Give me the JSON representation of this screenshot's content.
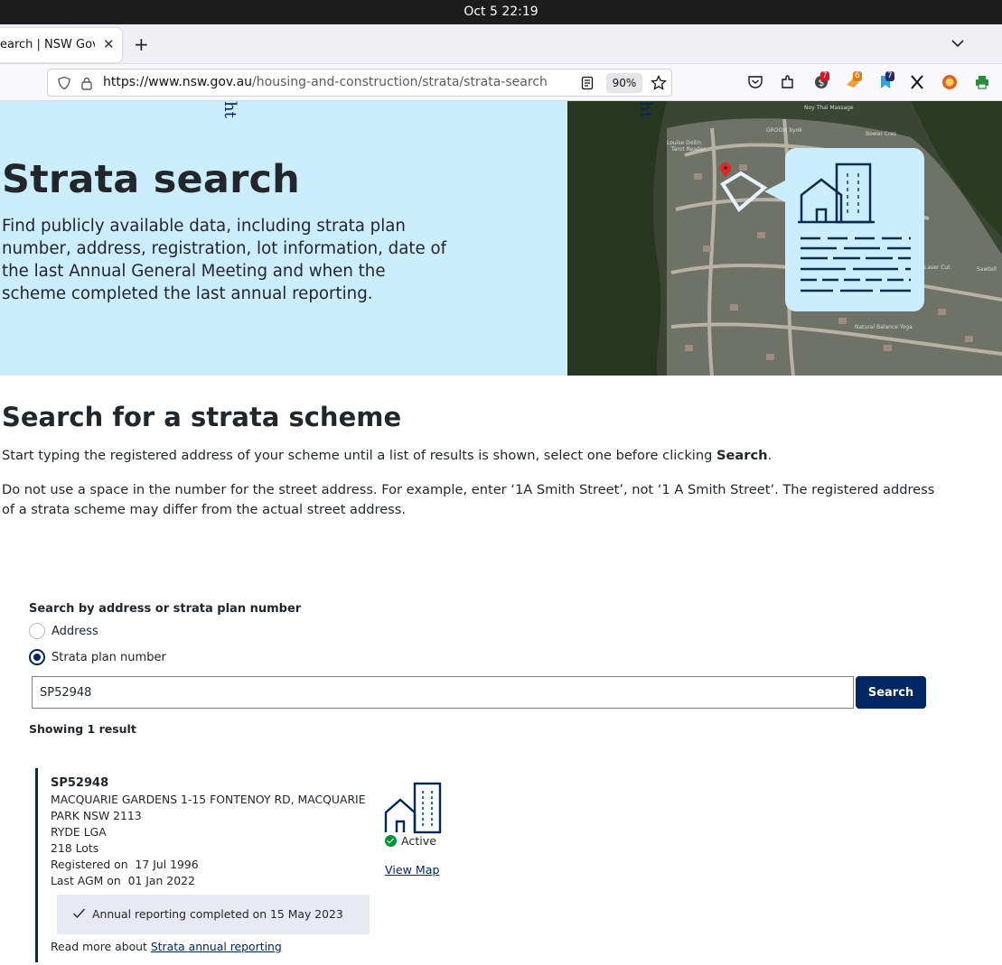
{
  "os": {
    "datetime": "Oct 5  22:19"
  },
  "browser": {
    "tab_title": "earch | NSW Gove",
    "new_tab": "+",
    "url_host": "https://www.nsw.gov.au",
    "url_path": "/housing-and-construction/strata/strata-search",
    "zoom": "90%",
    "ext_badges": [
      "7",
      "6",
      "7"
    ]
  },
  "hero": {
    "vertical_text": "ht",
    "title": "Strata search",
    "description": "Find publicly available data, including strata plan number, address, registration, lot information, date of the last Annual General Meeting and when the scheme completed the last annual reporting."
  },
  "search_section": {
    "heading": "Search for a strata scheme",
    "intro1_before": "Start typing the registered address of your scheme until a list of results is shown, select one before clicking ",
    "intro1_bold": "Search",
    "intro1_after": ".",
    "intro2": "Do not use a space in the number for the street address. For example, enter ‘1A Smith Street’, not ‘1 A Smith Street’. The registered address of a strata scheme may differ from the actual street address.",
    "search_by_label": "Search by address or strata plan number",
    "options": [
      {
        "label": "Address",
        "checked": false
      },
      {
        "label": "Strata plan number",
        "checked": true
      }
    ],
    "input_value": "SP52948",
    "button_label": "Search",
    "showing": "Showing 1 result"
  },
  "result": {
    "id": "SP52948",
    "address_line1": "MACQUARIE GARDENS 1-15 FONTENOY RD, MACQUARIE",
    "address_line2": "PARK NSW 2113",
    "lga": "RYDE LGA",
    "lots": "218 Lots",
    "registered_label": "Registered on",
    "registered_date": "17 Jul 1996",
    "agm_label": "Last AGM on",
    "agm_date": "01 Jan 2022",
    "status": "Active",
    "view_map": "View Map",
    "annual_reporting": "Annual reporting completed on 15 May 2023",
    "read_more_prefix": "Read more about",
    "read_more_link": "Strata annual reporting"
  },
  "map_labels": [
    "Noy Thai Massage",
    "GROOM byok",
    "Bower Cres",
    "Louise Dollin Tarot Reader",
    "Laser Cut",
    "Sawtell",
    "Natural Balance Yoga"
  ],
  "colors": {
    "navy": "#002664",
    "hero_bg": "#cbedfd",
    "active_green": "#009639"
  }
}
